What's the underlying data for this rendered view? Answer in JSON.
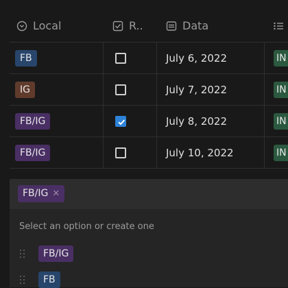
{
  "table": {
    "headers": [
      {
        "label": "Local",
        "icon": "select-circle-icon"
      },
      {
        "label": "R..",
        "icon": "checkbox-icon"
      },
      {
        "label": "Data",
        "icon": "calendar-icon"
      },
      {
        "label": "",
        "icon": "list-icon"
      }
    ],
    "rows": [
      {
        "local": "FB",
        "local_color": "#28456c",
        "checked": false,
        "date": "July 6, 2022",
        "status": "IN"
      },
      {
        "local": "IG",
        "local_color": "#603b2c",
        "checked": false,
        "date": "July 7, 2022",
        "status": "IN"
      },
      {
        "local": "FB/IG",
        "local_color": "#492f64",
        "checked": true,
        "date": "July 8, 2022",
        "status": "IN"
      },
      {
        "local": "FB/IG",
        "local_color": "#492f64",
        "checked": false,
        "date": "July 10, 2022",
        "status": "IN"
      }
    ]
  },
  "popup": {
    "selected_tag": "FB/IG",
    "remove_icon": "close-icon",
    "help_text": "Select an option or create one",
    "options": [
      {
        "label": "FB/IG",
        "color": "#492f64"
      },
      {
        "label": "FB",
        "color": "#28456c"
      }
    ]
  },
  "colors": {
    "background": "#191919",
    "checkbox_checked": "#2e83d8",
    "status_green": "#2b593f"
  }
}
